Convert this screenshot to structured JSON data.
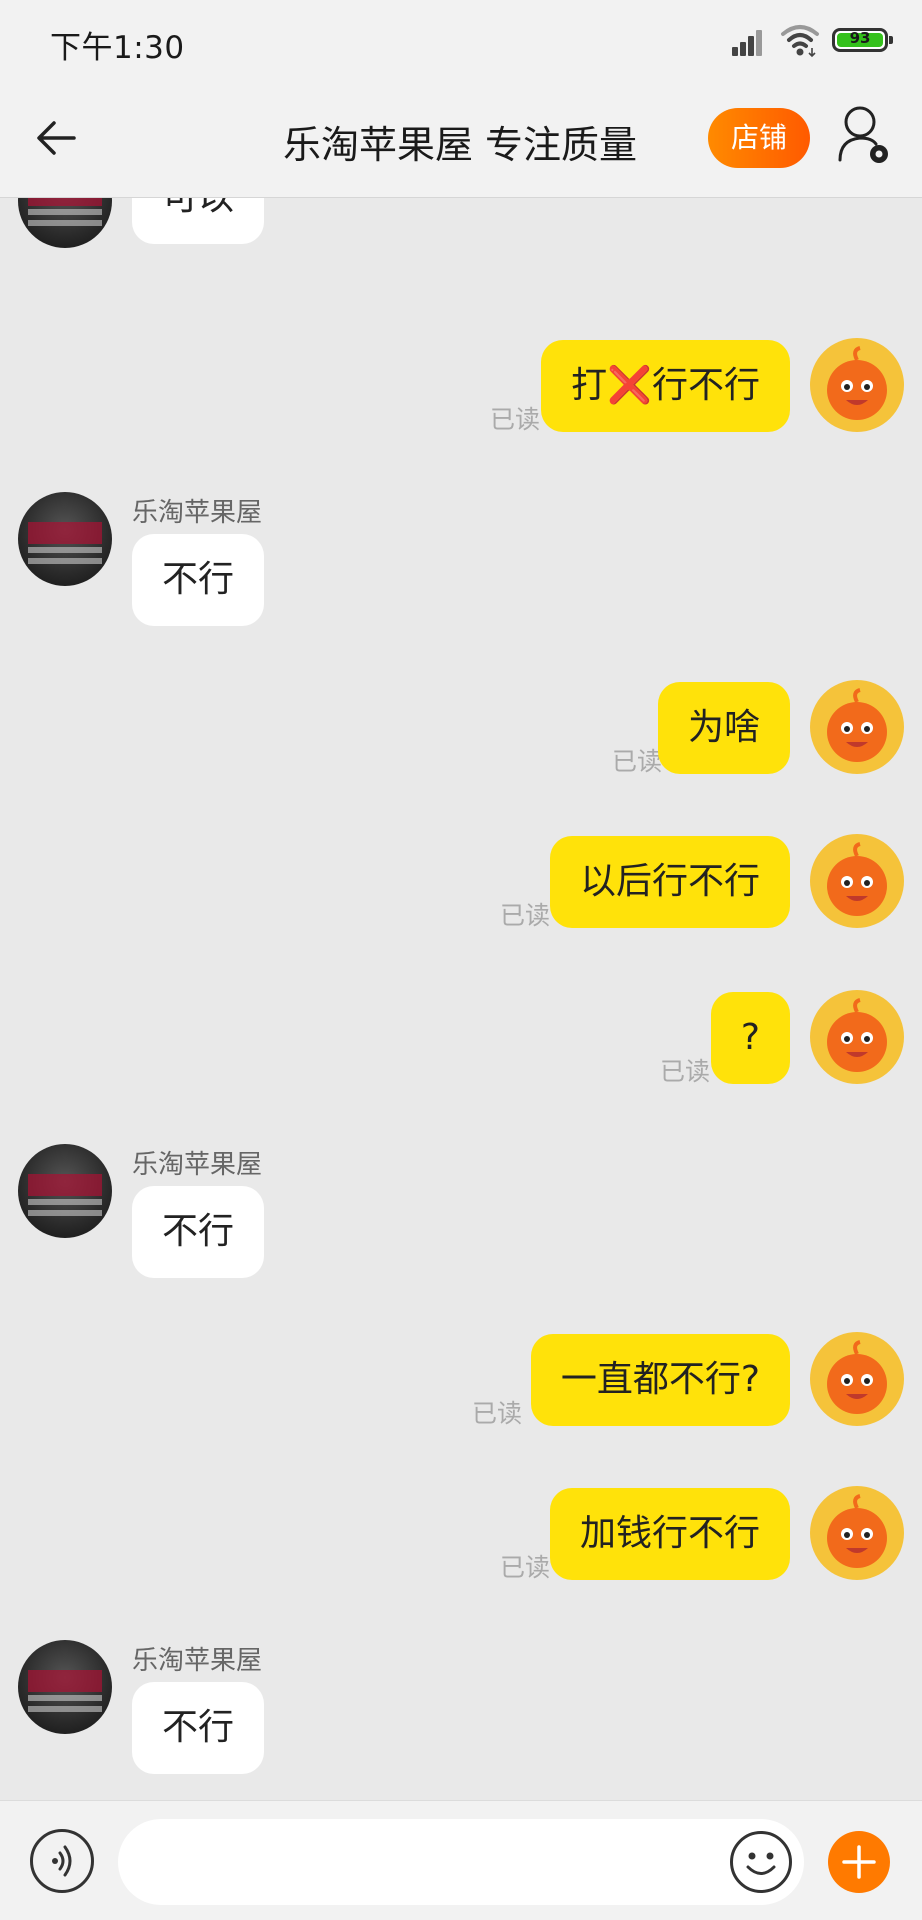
{
  "status_bar": {
    "time": "下午1:30",
    "battery": "93",
    "icons": [
      "signal-icon",
      "wifi-icon",
      "battery-icon"
    ]
  },
  "header": {
    "title": "乐淘苹果屋 专注质量",
    "store_label": "店铺",
    "back_icon": "back-arrow-icon",
    "profile_icon": "user-settings-icon"
  },
  "messages": [
    {
      "side": "in",
      "text": "可以"
    },
    {
      "side": "out",
      "text": "打❌行不行",
      "read": "已读"
    },
    {
      "side": "in",
      "sender": "乐淘苹果屋",
      "text": "不行"
    },
    {
      "side": "out",
      "text": "为啥",
      "read": "已读"
    },
    {
      "side": "out",
      "text": "以后行不行",
      "read": "已读"
    },
    {
      "side": "out",
      "text": "?",
      "read": "已读"
    },
    {
      "side": "in",
      "sender": "乐淘苹果屋",
      "text": "不行"
    },
    {
      "side": "out",
      "text": "一直都不行?",
      "read": "已读"
    },
    {
      "side": "out",
      "text": "加钱行不行",
      "read": "已读"
    },
    {
      "side": "in",
      "sender": "乐淘苹果屋",
      "text": "不行"
    }
  ],
  "input_bar": {
    "placeholder": "",
    "voice_icon": "voice-icon",
    "emoji_icon": "emoji-icon",
    "plus_icon": "plus-icon"
  },
  "colors": {
    "outgoing_bubble": "#ffe20a",
    "incoming_bubble": "#ffffff",
    "accent": "#ff7a00",
    "background": "#e9e9e9"
  }
}
